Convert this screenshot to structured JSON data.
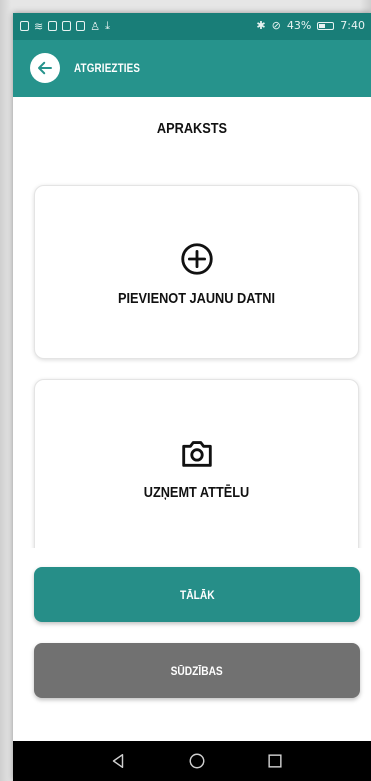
{
  "status_bar": {
    "battery_text": "43%",
    "time": "7:40"
  },
  "app_bar": {
    "back_label": "ATGRIEZTIES",
    "back_icon": "arrow-left-icon"
  },
  "page": {
    "title": "APRAKSTS"
  },
  "cards": [
    {
      "label": "PIEVIENOT JAUNU DATNI",
      "icon": "add-circle-icon"
    },
    {
      "label": "UZŅEMT ATTĒLU",
      "icon": "camera-icon"
    }
  ],
  "buttons": {
    "next_label": "TĀLĀK",
    "complaints_label": "SŪDZĪBAS"
  },
  "colors": {
    "status_bar": "#197e78",
    "app_bar": "#26938c",
    "primary_button": "#268e88",
    "secondary_button": "#717171"
  },
  "navigation": {
    "back_icon": "nav-back-icon",
    "home_icon": "nav-home-icon",
    "recents_icon": "nav-recents-icon"
  }
}
